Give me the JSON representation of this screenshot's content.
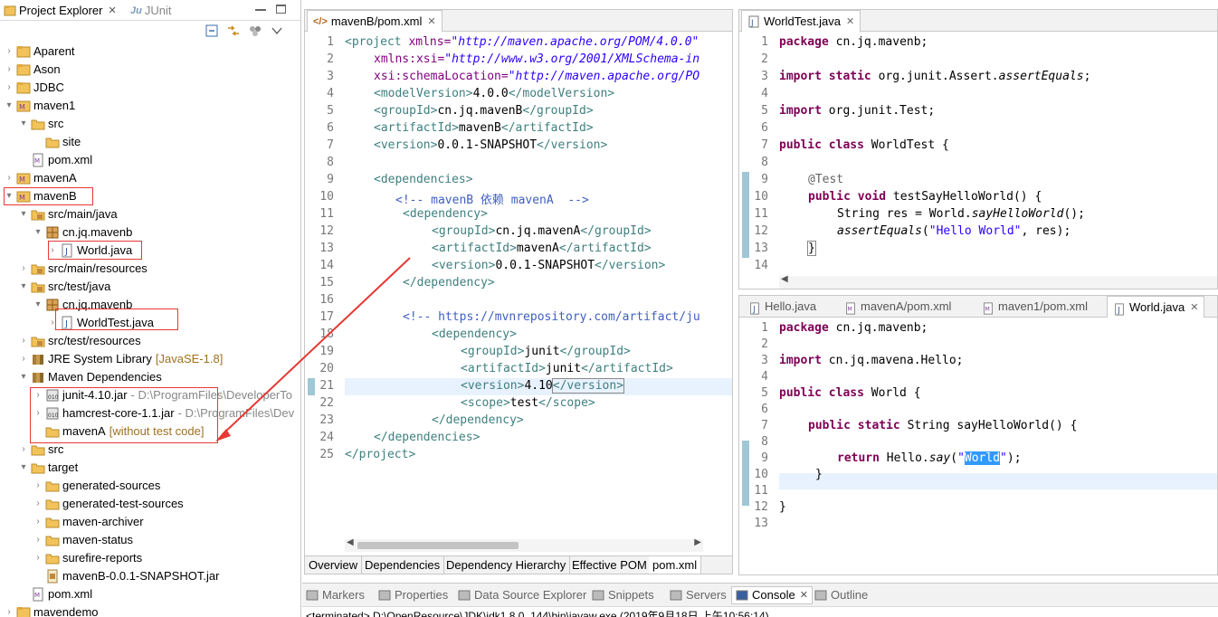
{
  "project_explorer": {
    "tab_label": "Project Explorer",
    "junit_tab_label": "JUnit",
    "tree": [
      {
        "label": "Aparent"
      },
      {
        "label": "Ason"
      },
      {
        "label": "JDBC"
      },
      {
        "label": "maven1"
      },
      {
        "label": "src"
      },
      {
        "label": "site"
      },
      {
        "label": "pom.xml"
      },
      {
        "label": "mavenA"
      },
      {
        "label": "mavenB"
      },
      {
        "label": "src/main/java"
      },
      {
        "label": "cn.jq.mavenb"
      },
      {
        "label": "World.java"
      },
      {
        "label": "src/main/resources"
      },
      {
        "label": "src/test/java"
      },
      {
        "label": "cn.jq.mavenb"
      },
      {
        "label": "WorldTest.java"
      },
      {
        "label": "src/test/resources"
      },
      {
        "label": "JRE System Library",
        "deco": "[JavaSE-1.8]"
      },
      {
        "label": "Maven Dependencies"
      },
      {
        "label": "junit-4.10.jar",
        "deco": "- D:\\ProgramFiles\\DeveloperTo"
      },
      {
        "label": "hamcrest-core-1.1.jar",
        "deco": "- D:\\ProgramFiles\\Dev"
      },
      {
        "label": "mavenA",
        "deco": "[without test code]"
      },
      {
        "label": "src"
      },
      {
        "label": "target"
      },
      {
        "label": "generated-sources"
      },
      {
        "label": "generated-test-sources"
      },
      {
        "label": "maven-archiver"
      },
      {
        "label": "maven-status"
      },
      {
        "label": "surefire-reports"
      },
      {
        "label": "mavenB-0.0.1-SNAPSHOT.jar"
      },
      {
        "label": "pom.xml"
      },
      {
        "label": "mavendemo"
      }
    ]
  },
  "pom_editor": {
    "tab_label": "mavenB/pom.xml",
    "line_numbers": [
      "1",
      "2",
      "3",
      "4",
      "5",
      "6",
      "7",
      "8",
      "9",
      "10",
      "11",
      "12",
      "13",
      "14",
      "15",
      "16",
      "17",
      "18",
      "19",
      "20",
      "21",
      "22",
      "23",
      "24",
      "25"
    ],
    "bottom_tabs": [
      "Overview",
      "Dependencies",
      "Dependency Hierarchy",
      "Effective POM",
      "pom.xml"
    ],
    "lines": {
      "l1_tag": "<project ",
      "l1_attr": "xmlns=",
      "l1_val": "\"http://maven.apache.org/POM/4.0.0\"",
      "l2_attr": "xmlns:xsi=",
      "l2_val": "\"http://www.w3.org/2001/XMLSchema-in",
      "l3_attr": "xsi:schemaLocation=",
      "l3_val": "\"http://maven.apache.org/PO",
      "l4_open": "<modelVersion>",
      "l4_text": "4.0.0",
      "l4_close": "</modelVersion>",
      "l5_open": "<groupId>",
      "l5_text": "cn.jq.mavenB",
      "l5_close": "</groupId>",
      "l6_open": "<artifactId>",
      "l6_text": "mavenB",
      "l6_close": "</artifactId>",
      "l7_open": "<version>",
      "l7_text": "0.0.1-SNAPSHOT",
      "l7_close": "</version>",
      "l9": "<dependencies>",
      "l10": "<!-- mavenB 依赖 mavenA  -->",
      "l11": "<dependency>",
      "l12_open": "<groupId>",
      "l12_text": "cn.jq.mavenA",
      "l12_close": "</groupId>",
      "l13_open": "<artifactId>",
      "l13_text": "mavenA",
      "l13_close": "</artifactId>",
      "l14_open": "<version>",
      "l14_text": "0.0.1-SNAPSHOT",
      "l14_close": "</version>",
      "l15": "</dependency>",
      "l17": "<!-- https://mvnrepository.com/artifact/ju",
      "l18": "<dependency>",
      "l19_open": "<groupId>",
      "l19_text": "junit",
      "l19_close": "</groupId>",
      "l20_open": "<artifactId>",
      "l20_text": "junit",
      "l20_close": "</artifactId>",
      "l21_open": "<version>",
      "l21_text": "4.10",
      "l21_close": "</version>",
      "l22_open": "<scope>",
      "l22_text": "test",
      "l22_close": "</scope>",
      "l23": "</dependency>",
      "l24": "</dependencies>",
      "l25": "</project>"
    }
  },
  "worldtest_editor": {
    "tab_label": "WorldTest.java",
    "line_numbers": [
      "1",
      "2",
      "3",
      "4",
      "5",
      "6",
      "7",
      "8",
      "9",
      "10",
      "11",
      "12",
      "13",
      "14"
    ],
    "lines": {
      "l1_kw": "package",
      "l1_rest": " cn.jq.mavenb;",
      "l3_kw": "import static",
      "l3_rest": " org.junit.Assert.",
      "l3_it": "assertEquals",
      "l3_end": ";",
      "l5_kw": "import",
      "l5_rest": " org.junit.Test;",
      "l7_kw": "public class",
      "l7_rest": " WorldTest {",
      "l9": "@Test",
      "l10_kw": "public void",
      "l10_rest": " testSayHelloWorld() {",
      "l11_a": "String res = World.",
      "l11_it": "sayHelloWorld",
      "l11_b": "();",
      "l12_it": "assertEquals",
      "l12_a": "(",
      "l12_str": "\"Hello World\"",
      "l12_b": ", res);",
      "l13": "}"
    }
  },
  "world_editor": {
    "tabs": [
      "Hello.java",
      "mavenA/pom.xml",
      "maven1/pom.xml",
      "World.java"
    ],
    "line_numbers": [
      "1",
      "2",
      "3",
      "4",
      "5",
      "6",
      "7",
      "8",
      "9",
      "10",
      "11",
      "12",
      "13"
    ],
    "lines": {
      "l1_kw": "package",
      "l1_rest": " cn.jq.mavenb;",
      "l3_kw": "import",
      "l3_rest": " cn.jq.mavena.Hello;",
      "l5_kw": "public class",
      "l5_rest": " World {",
      "l7_kw": "public static",
      "l7_rest": " String sayHelloWorld() {",
      "l9_kw": "return",
      "l9_a": " Hello.",
      "l9_it": "say",
      "l9_b": "(",
      "l9_q1": "\"",
      "l9_sel": "World",
      "l9_q2": "\"",
      "l9_c": ");",
      "l10": "}",
      "l12": "}"
    }
  },
  "bottom_panel": {
    "tabs": [
      "Markers",
      "Properties",
      "Data Source Explorer",
      "Snippets",
      "Servers",
      "Console",
      "Outline"
    ],
    "console_text": "<terminated> D:\\OpenResource\\JDK\\jdk1.8.0_144\\bin\\javaw.exe (2019年9月18日 上午10:56:14)"
  }
}
